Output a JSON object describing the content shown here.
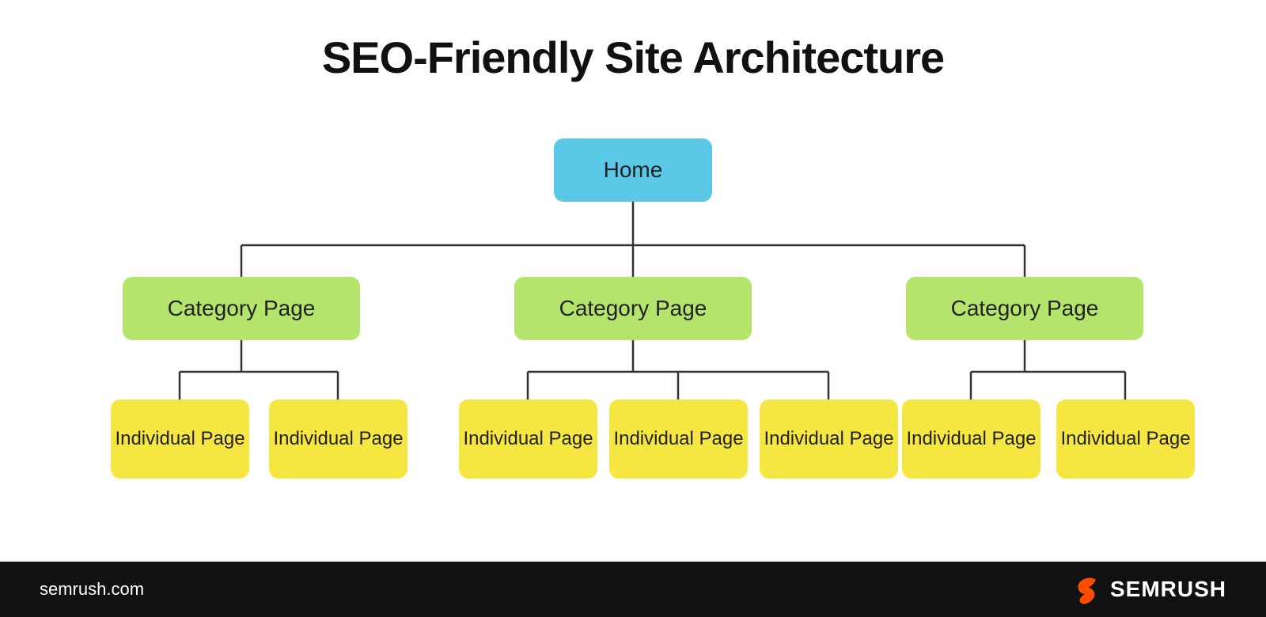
{
  "title": "SEO-Friendly Site Architecture",
  "nodes": {
    "home": "Home",
    "category_label": "Category Page",
    "individual_label": "Individual Page"
  },
  "footer": {
    "url": "semrush.com",
    "brand": "SEMRUSH"
  },
  "colors": {
    "home_bg": "#5bc8e8",
    "category_bg": "#b5e46d",
    "individual_bg": "#f5e642",
    "footer_bg": "#111111",
    "semrush_orange": "#ff4d00"
  }
}
